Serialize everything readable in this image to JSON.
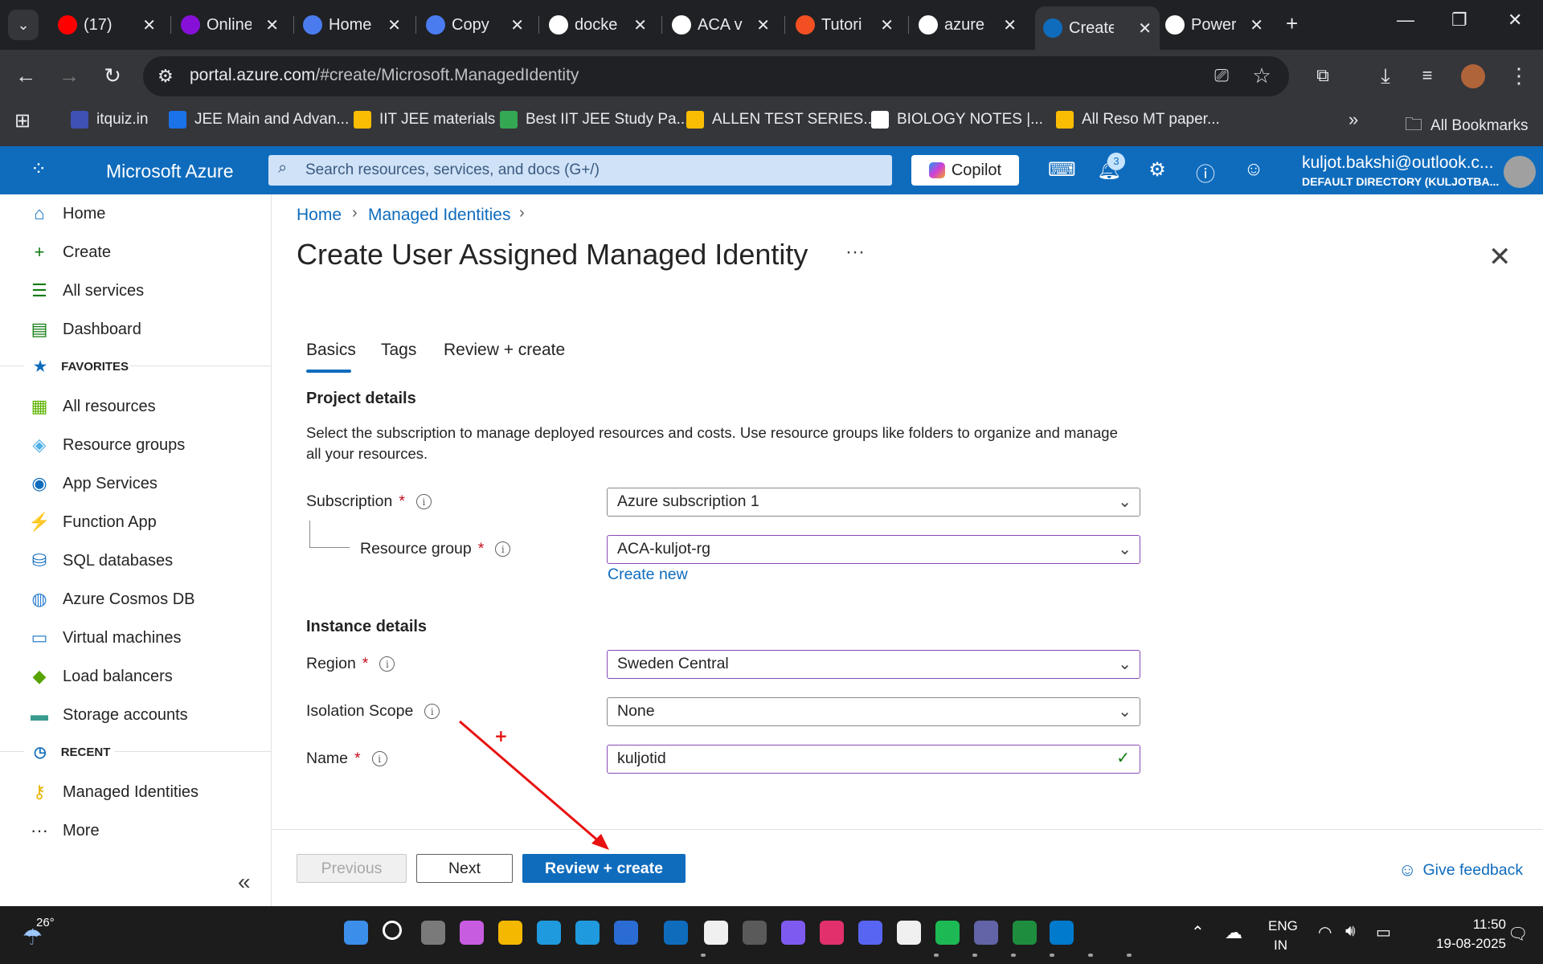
{
  "browser": {
    "tabs": [
      {
        "title": "(17)",
        "icon": "youtube-icon",
        "color": "#ff0000"
      },
      {
        "title": "Online",
        "icon": "udemy-icon",
        "color": "#8710d8"
      },
      {
        "title": "Home",
        "icon": "copilot-c-icon",
        "color": "#4a7cf0"
      },
      {
        "title": "Copy",
        "icon": "copilot-c-icon",
        "color": "#4a7cf0"
      },
      {
        "title": "docke",
        "icon": "google-icon",
        "color": "#ffffff"
      },
      {
        "title": "ACA v",
        "icon": "openai-icon",
        "color": "#ffffff"
      },
      {
        "title": "Tutori",
        "icon": "microsoft-icon",
        "color": "#f25022"
      },
      {
        "title": "azure",
        "icon": "google-icon",
        "color": "#ffffff"
      },
      {
        "title": "Create",
        "icon": "azure-icon",
        "color": "#0f6cbd"
      },
      {
        "title": "Power",
        "icon": "openai-icon",
        "color": "#ffffff"
      }
    ],
    "url_host": "portal.azure.com",
    "url_path": "/#create/Microsoft.ManagedIdentity",
    "bookmarks": [
      {
        "label": "itquiz.in",
        "color": "#3f51b5"
      },
      {
        "label": "JEE Main and Advan...",
        "color": "#1a73e8"
      },
      {
        "label": "IIT JEE materials",
        "color": "#fbbc04"
      },
      {
        "label": "Best IIT JEE Study Pa...",
        "color": "#34a853"
      },
      {
        "label": "ALLEN TEST SERIES...",
        "color": "#fbbc04"
      },
      {
        "label": "BIOLOGY NOTES |...",
        "color": "#ffffff"
      },
      {
        "label": "All Reso MT paper...",
        "color": "#fbbc04"
      }
    ],
    "all_bookmarks": "All Bookmarks"
  },
  "azure": {
    "brand": "Microsoft Azure",
    "search_placeholder": "Search resources, services, and docs (G+/)",
    "copilot": "Copilot",
    "notification_count": "3",
    "account_email": "kuljot.bakshi@outlook.c...",
    "account_directory": "DEFAULT DIRECTORY (KULJOTBA..."
  },
  "sidebar": {
    "top": [
      {
        "label": "Home",
        "icon": "home-icon",
        "glyph": "⌂",
        "color": "#0f6cbd"
      },
      {
        "label": "Create",
        "icon": "plus-icon",
        "glyph": "+",
        "color": "#107c10"
      },
      {
        "label": "All services",
        "icon": "list-icon",
        "glyph": "☰",
        "color": "#107c10"
      },
      {
        "label": "Dashboard",
        "icon": "dashboard-icon",
        "glyph": "▤",
        "color": "#107c10"
      }
    ],
    "favorites_label": "FAVORITES",
    "favorites": [
      {
        "label": "All resources",
        "icon": "grid-icon",
        "glyph": "▦",
        "color": "#5db300"
      },
      {
        "label": "Resource groups",
        "icon": "resource-group-icon",
        "glyph": "◈",
        "color": "#50b0e8"
      },
      {
        "label": "App Services",
        "icon": "globe-icon",
        "glyph": "◉",
        "color": "#0f6cbd"
      },
      {
        "label": "Function App",
        "icon": "lightning-icon",
        "glyph": "⚡",
        "color": "#f0b400"
      },
      {
        "label": "SQL databases",
        "icon": "database-icon",
        "glyph": "⛁",
        "color": "#0f6cbd"
      },
      {
        "label": "Azure Cosmos DB",
        "icon": "planet-icon",
        "glyph": "◍",
        "color": "#2f7fcf"
      },
      {
        "label": "Virtual machines",
        "icon": "monitor-icon",
        "glyph": "▭",
        "color": "#2f7fcf"
      },
      {
        "label": "Load balancers",
        "icon": "diamond-icon",
        "glyph": "◆",
        "color": "#57a300"
      },
      {
        "label": "Storage accounts",
        "icon": "storage-icon",
        "glyph": "▬",
        "color": "#3a9b8f"
      }
    ],
    "recent_label": "RECENT",
    "recent": [
      {
        "label": "Managed Identities",
        "icon": "key-icon",
        "glyph": "⚷",
        "color": "#e8b400"
      }
    ],
    "more": "More"
  },
  "page": {
    "breadcrumb": [
      "Home",
      "Managed Identities"
    ],
    "title": "Create User Assigned Managed Identity",
    "tabs": [
      "Basics",
      "Tags",
      "Review + create"
    ],
    "project_heading": "Project details",
    "project_desc": "Select the subscription to manage deployed resources and costs. Use resource groups like folders to organize and manage all your resources.",
    "subscription_label": "Subscription",
    "subscription_value": "Azure subscription 1",
    "rg_label": "Resource group",
    "rg_value": "ACA-kuljot-rg",
    "create_new": "Create new",
    "instance_heading": "Instance details",
    "region_label": "Region",
    "region_value": "Sweden Central",
    "isolation_label": "Isolation Scope",
    "isolation_value": "None",
    "name_label": "Name",
    "name_value": "kuljotid"
  },
  "footer": {
    "previous": "Previous",
    "next": "Next",
    "review_create": "Review + create",
    "feedback": "Give feedback"
  },
  "taskbar": {
    "temperature": "26°",
    "lang_line1": "ENG",
    "lang_line2": "IN",
    "time": "11:50",
    "date": "19-08-2025"
  },
  "colors": {
    "azure_blue": "#0f6cbd",
    "annotation_red": "#e81010"
  }
}
